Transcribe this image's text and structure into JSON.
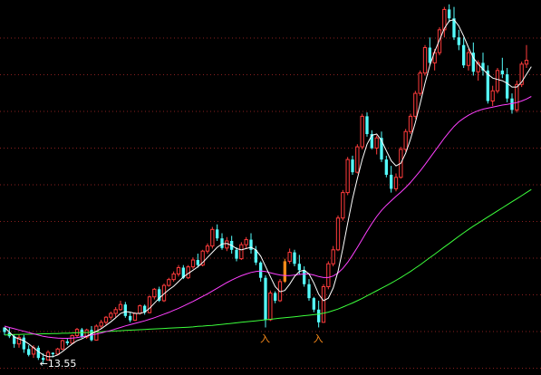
{
  "chart_data": {
    "type": "candlestick",
    "title": "",
    "xlabel": "",
    "ylabel": "",
    "y_range": [
      13.2,
      27.8
    ],
    "grid": "horizontal-dotted",
    "colors": {
      "background": "#000000",
      "up": "#ff3c3c",
      "down": "#54fcfc",
      "grid": "#8a1f1f",
      "ma_short": "#ffffff",
      "ma_mid": "#ff40ff",
      "ma_long": "#3cff3c",
      "signal": "#ff8c1a",
      "low_marker": "#ffffff"
    },
    "candles": [
      [
        15.0,
        15.0,
        14.7,
        14.82
      ],
      [
        14.8,
        14.98,
        14.58,
        14.65
      ],
      [
        14.65,
        14.72,
        14.2,
        14.35
      ],
      [
        14.35,
        14.72,
        14.2,
        14.6
      ],
      [
        14.6,
        14.7,
        14.0,
        14.14
      ],
      [
        14.15,
        14.3,
        13.86,
        13.92
      ],
      [
        13.95,
        14.3,
        13.8,
        14.2
      ],
      [
        14.2,
        14.28,
        13.72,
        13.8
      ],
      [
        13.8,
        13.98,
        13.55,
        13.72
      ],
      [
        13.72,
        14.1,
        13.7,
        14.02
      ],
      [
        14.0,
        14.02,
        13.82,
        13.95
      ],
      [
        13.95,
        14.2,
        13.9,
        14.15
      ],
      [
        14.15,
        14.52,
        14.1,
        14.48
      ],
      [
        14.45,
        14.55,
        14.3,
        14.38
      ],
      [
        14.38,
        14.72,
        14.35,
        14.68
      ],
      [
        14.68,
        14.98,
        14.6,
        14.92
      ],
      [
        14.92,
        14.98,
        14.58,
        14.62
      ],
      [
        14.62,
        14.95,
        14.55,
        14.9
      ],
      [
        14.9,
        15.05,
        14.45,
        14.5
      ],
      [
        14.5,
        15.12,
        14.48,
        15.05
      ],
      [
        15.05,
        15.3,
        14.95,
        15.2
      ],
      [
        15.2,
        15.45,
        15.1,
        15.4
      ],
      [
        15.4,
        15.62,
        15.3,
        15.55
      ],
      [
        15.55,
        15.8,
        15.4,
        15.7
      ],
      [
        15.7,
        16.05,
        15.65,
        15.9
      ],
      [
        15.9,
        16.0,
        15.38,
        15.45
      ],
      [
        15.45,
        15.58,
        15.2,
        15.28
      ],
      [
        15.28,
        15.6,
        15.25,
        15.55
      ],
      [
        15.55,
        15.9,
        15.5,
        15.85
      ],
      [
        15.85,
        15.9,
        15.5,
        15.58
      ],
      [
        15.58,
        16.25,
        15.55,
        16.2
      ],
      [
        16.2,
        16.55,
        16.1,
        16.5
      ],
      [
        16.5,
        16.6,
        16.0,
        16.05
      ],
      [
        16.05,
        16.72,
        16.0,
        16.65
      ],
      [
        16.65,
        16.95,
        16.6,
        16.88
      ],
      [
        16.88,
        17.2,
        16.8,
        17.1
      ],
      [
        17.1,
        17.45,
        17.0,
        17.35
      ],
      [
        17.35,
        17.45,
        16.9,
        16.95
      ],
      [
        16.95,
        17.45,
        16.9,
        17.38
      ],
      [
        17.38,
        17.75,
        17.3,
        17.65
      ],
      [
        17.65,
        17.9,
        17.35,
        17.45
      ],
      [
        17.45,
        18.05,
        17.4,
        18.0
      ],
      [
        18.0,
        18.3,
        17.9,
        18.2
      ],
      [
        18.2,
        18.95,
        18.1,
        18.85
      ],
      [
        18.85,
        19.05,
        18.4,
        18.5
      ],
      [
        18.5,
        18.7,
        18.05,
        18.12
      ],
      [
        18.12,
        18.55,
        18.0,
        18.4
      ],
      [
        18.4,
        18.6,
        17.9,
        18.05
      ],
      [
        18.05,
        18.15,
        17.6,
        17.7
      ],
      [
        17.7,
        18.35,
        17.65,
        18.25
      ],
      [
        18.25,
        18.55,
        18.1,
        18.45
      ],
      [
        18.45,
        18.7,
        17.9,
        18.05
      ],
      [
        18.05,
        18.2,
        17.45,
        17.55
      ],
      [
        17.55,
        17.6,
        16.8,
        16.95
      ],
      [
        16.95,
        17.05,
        15.0,
        15.3
      ],
      [
        15.3,
        16.45,
        15.25,
        16.35
      ],
      [
        16.35,
        16.42,
        15.95,
        16.05
      ],
      [
        16.05,
        16.9,
        16.0,
        16.8
      ],
      [
        16.8,
        17.7,
        16.75,
        17.6
      ],
      [
        17.6,
        18.1,
        17.5,
        17.95
      ],
      [
        17.95,
        18.05,
        17.4,
        17.5
      ],
      [
        17.5,
        17.85,
        17.1,
        17.25
      ],
      [
        17.25,
        17.4,
        16.6,
        16.7
      ],
      [
        16.7,
        16.9,
        16.05,
        16.15
      ],
      [
        16.15,
        16.2,
        15.6,
        15.7
      ],
      [
        15.7,
        16.05,
        15.0,
        15.2
      ],
      [
        15.2,
        16.7,
        15.18,
        16.6
      ],
      [
        16.6,
        17.6,
        16.5,
        17.5
      ],
      [
        17.5,
        18.2,
        17.4,
        18.05
      ],
      [
        18.05,
        19.4,
        18.0,
        19.3
      ],
      [
        19.3,
        20.4,
        19.2,
        20.3
      ],
      [
        20.3,
        21.7,
        20.2,
        21.6
      ],
      [
        21.6,
        21.75,
        21.0,
        21.1
      ],
      [
        21.1,
        22.2,
        21.05,
        22.1
      ],
      [
        22.1,
        23.4,
        22.0,
        23.3
      ],
      [
        23.3,
        23.45,
        22.5,
        22.6
      ],
      [
        22.6,
        22.75,
        22.0,
        22.05
      ],
      [
        22.05,
        22.55,
        21.8,
        22.45
      ],
      [
        22.45,
        22.7,
        21.5,
        21.6
      ],
      [
        21.6,
        21.75,
        20.9,
        21.0
      ],
      [
        21.0,
        21.35,
        20.3,
        20.45
      ],
      [
        20.45,
        21.05,
        20.35,
        20.9
      ],
      [
        20.9,
        22.1,
        20.85,
        22.0
      ],
      [
        22.0,
        22.8,
        21.9,
        22.7
      ],
      [
        22.7,
        23.4,
        22.6,
        23.3
      ],
      [
        23.3,
        24.3,
        23.2,
        24.2
      ],
      [
        24.2,
        25.1,
        24.1,
        25.0
      ],
      [
        25.0,
        26.1,
        24.9,
        26.0
      ],
      [
        26.0,
        26.4,
        25.3,
        25.4
      ],
      [
        25.4,
        25.95,
        25.1,
        25.8
      ],
      [
        25.8,
        26.8,
        25.7,
        26.7
      ],
      [
        26.7,
        27.6,
        26.4,
        27.5
      ],
      [
        27.5,
        27.7,
        27.0,
        27.15
      ],
      [
        27.15,
        27.6,
        26.3,
        26.4
      ],
      [
        26.4,
        26.7,
        25.9,
        26.1
      ],
      [
        26.1,
        26.4,
        25.2,
        25.3
      ],
      [
        25.3,
        25.95,
        25.1,
        25.8
      ],
      [
        25.8,
        26.2,
        24.9,
        25.05
      ],
      [
        25.05,
        25.5,
        24.7,
        25.4
      ],
      [
        25.4,
        25.8,
        24.9,
        25.1
      ],
      [
        25.1,
        25.3,
        23.8,
        23.9
      ],
      [
        23.9,
        24.5,
        23.7,
        24.3
      ],
      [
        24.3,
        25.2,
        24.2,
        25.1
      ],
      [
        25.1,
        25.6,
        24.8,
        24.95
      ],
      [
        24.95,
        25.2,
        23.85,
        24.0
      ],
      [
        24.0,
        24.2,
        23.4,
        23.55
      ],
      [
        23.55,
        24.7,
        23.45,
        24.55
      ],
      [
        24.55,
        25.45,
        24.45,
        25.35
      ],
      [
        25.35,
        26.1,
        25.2,
        25.5
      ]
    ],
    "ma_short": [
      15.0,
      14.82,
      14.62,
      14.55,
      14.48,
      14.35,
      14.2,
      14.05,
      13.92,
      13.85,
      13.85,
      13.92,
      14.05,
      14.2,
      14.35,
      14.48,
      14.55,
      14.65,
      14.75,
      14.85,
      14.95,
      15.08,
      15.22,
      15.38,
      15.55,
      15.62,
      15.6,
      15.55,
      15.55,
      15.6,
      15.75,
      15.95,
      16.15,
      16.32,
      16.48,
      16.62,
      16.8,
      16.98,
      17.12,
      17.25,
      17.38,
      17.55,
      17.75,
      17.95,
      18.15,
      18.28,
      18.3,
      18.22,
      18.1,
      18.05,
      18.1,
      18.15,
      18.05,
      17.8,
      17.4,
      17.0,
      16.6,
      16.4,
      16.45,
      16.7,
      17.0,
      17.2,
      17.25,
      17.1,
      16.75,
      16.3,
      16.05,
      16.15,
      16.55,
      17.2,
      18.1,
      19.1,
      20.05,
      20.85,
      21.6,
      22.2,
      22.55,
      22.6,
      22.35,
      21.95,
      21.55,
      21.35,
      21.45,
      21.85,
      22.4,
      23.05,
      23.8,
      24.6,
      25.3,
      25.85,
      26.3,
      26.75,
      27.05,
      27.1,
      26.85,
      26.45,
      26.0,
      25.6,
      25.35,
      25.15,
      24.95,
      24.8,
      24.75,
      24.7,
      24.6,
      24.45,
      24.45,
      24.65,
      24.95,
      25.25
    ],
    "ma_mid": [
      15.05,
      15.0,
      14.95,
      14.9,
      14.85,
      14.8,
      14.75,
      14.7,
      14.65,
      14.62,
      14.6,
      14.58,
      14.57,
      14.57,
      14.58,
      14.6,
      14.63,
      14.66,
      14.7,
      14.74,
      14.78,
      14.83,
      14.88,
      14.94,
      15.0,
      15.06,
      15.11,
      15.16,
      15.21,
      15.26,
      15.32,
      15.38,
      15.45,
      15.52,
      15.59,
      15.67,
      15.75,
      15.84,
      15.93,
      16.02,
      16.12,
      16.22,
      16.32,
      16.43,
      16.54,
      16.65,
      16.76,
      16.86,
      16.95,
      17.03,
      17.1,
      17.16,
      17.2,
      17.22,
      17.2,
      17.15,
      17.1,
      17.06,
      17.04,
      17.04,
      17.06,
      17.08,
      17.1,
      17.1,
      17.06,
      17.0,
      16.96,
      16.96,
      17.02,
      17.14,
      17.32,
      17.56,
      17.84,
      18.14,
      18.46,
      18.78,
      19.08,
      19.36,
      19.6,
      19.8,
      19.98,
      20.15,
      20.32,
      20.5,
      20.7,
      20.92,
      21.15,
      21.4,
      21.66,
      21.92,
      22.18,
      22.44,
      22.68,
      22.9,
      23.08,
      23.22,
      23.34,
      23.44,
      23.52,
      23.58,
      23.62,
      23.66,
      23.7,
      23.74,
      23.77,
      23.8,
      23.84,
      23.9,
      23.98,
      24.08
    ],
    "ma_long": [
      14.7,
      14.71,
      14.72,
      14.72,
      14.73,
      14.73,
      14.74,
      14.74,
      14.75,
      14.75,
      14.76,
      14.76,
      14.77,
      14.77,
      14.78,
      14.79,
      14.79,
      14.8,
      14.81,
      14.82,
      14.83,
      14.84,
      14.85,
      14.86,
      14.87,
      14.88,
      14.89,
      14.9,
      14.91,
      14.92,
      14.93,
      14.94,
      14.95,
      14.96,
      14.97,
      14.98,
      14.99,
      15.0,
      15.01,
      15.02,
      15.04,
      15.05,
      15.07,
      15.08,
      15.1,
      15.12,
      15.14,
      15.16,
      15.18,
      15.2,
      15.22,
      15.24,
      15.26,
      15.28,
      15.3,
      15.32,
      15.34,
      15.36,
      15.38,
      15.4,
      15.42,
      15.44,
      15.46,
      15.48,
      15.5,
      15.52,
      15.56,
      15.6,
      15.66,
      15.72,
      15.8,
      15.88,
      15.96,
      16.05,
      16.14,
      16.24,
      16.34,
      16.44,
      16.54,
      16.64,
      16.74,
      16.85,
      16.96,
      17.08,
      17.2,
      17.33,
      17.46,
      17.6,
      17.74,
      17.88,
      18.02,
      18.16,
      18.3,
      18.44,
      18.58,
      18.72,
      18.85,
      18.98,
      19.1,
      19.22,
      19.34,
      19.46,
      19.58,
      19.7,
      19.82,
      19.94,
      20.06,
      20.18,
      20.3,
      20.42
    ],
    "annotations": [
      {
        "index": 8,
        "price": 13.55,
        "text": "←13.55",
        "kind": "low"
      },
      {
        "index": 54,
        "text": "入",
        "kind": "signal"
      },
      {
        "index": 65,
        "text": "入",
        "kind": "signal"
      }
    ],
    "signal_candles": [
      58
    ]
  }
}
